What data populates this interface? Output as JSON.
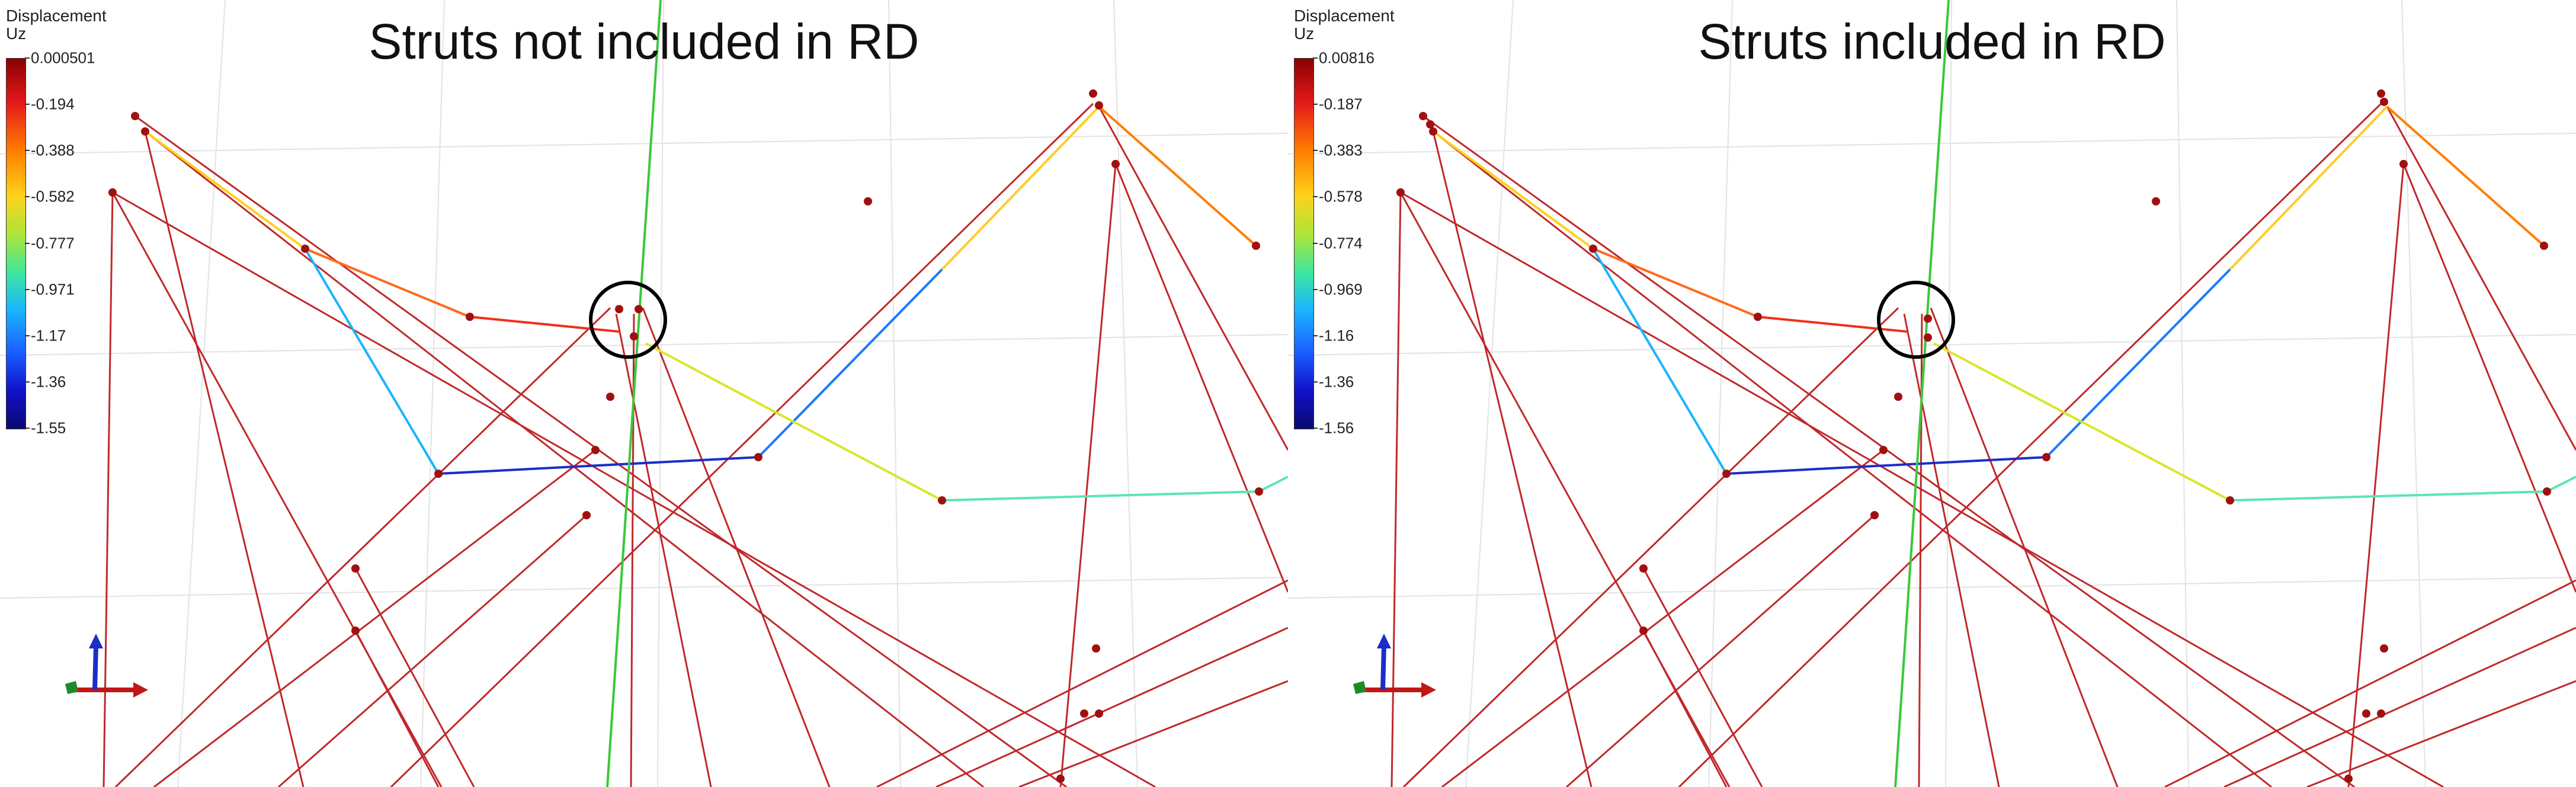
{
  "panels": [
    {
      "title": "Struts not included in RD",
      "legend": {
        "title_line1": "Displacement",
        "title_line2": "Uz",
        "ticks": [
          "0.000501",
          "-0.194",
          "-0.388",
          "-0.582",
          "-0.777",
          "-0.971",
          "-1.17",
          "-1.36",
          "-1.55"
        ]
      }
    },
    {
      "title": "Struts included in RD",
      "legend": {
        "title_line1": "Displacement",
        "title_line2": "Uz",
        "ticks": [
          "0.00816",
          "-0.187",
          "-0.383",
          "-0.578",
          "-0.774",
          "-0.969",
          "-1.16",
          "-1.36",
          "-1.56"
        ]
      }
    }
  ],
  "colors": {
    "strut": "#c0282a",
    "node": "#a01010",
    "green_line": "#3cc83c",
    "grid": "#e3e3e3",
    "circle": "#000000",
    "axis_x": "#c01818",
    "axis_y": "#1c8a2a",
    "axis_z": "#1a2ec8"
  }
}
